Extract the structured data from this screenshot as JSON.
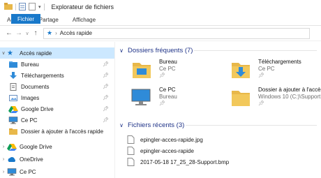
{
  "window": {
    "title": "Explorateur de fichiers"
  },
  "ribbon": {
    "tabs": [
      "Fichier",
      "Accueil",
      "Partage",
      "Affichage"
    ]
  },
  "address": {
    "path": "Accès rapide"
  },
  "sidebar": {
    "quick_access": "Accès rapide",
    "items": [
      {
        "label": "Bureau",
        "icon": "desktop-folder-icon"
      },
      {
        "label": "Téléchargements",
        "icon": "download-icon"
      },
      {
        "label": "Documents",
        "icon": "documents-icon"
      },
      {
        "label": "Images",
        "icon": "pictures-icon"
      },
      {
        "label": "Google Drive",
        "icon": "google-drive-icon"
      },
      {
        "label": "Ce PC",
        "icon": "computer-icon"
      },
      {
        "label": "Dossier à ajouter à l'accès rapide",
        "icon": "folder-icon"
      }
    ],
    "roots": [
      {
        "label": "Google Drive",
        "icon": "google-drive-icon"
      },
      {
        "label": "OneDrive",
        "icon": "onedrive-icon"
      },
      {
        "label": "Ce PC",
        "icon": "computer-icon"
      }
    ]
  },
  "frequent": {
    "header": "Dossiers fréquents (7)",
    "tiles": [
      {
        "name": "Bureau",
        "sub": "Ce PC"
      },
      {
        "name": "Téléchargements",
        "sub": "Ce PC"
      },
      {
        "name": "Ce PC",
        "sub": "Bureau"
      },
      {
        "name": "Dossier à ajouter à l'accès...",
        "sub": "Windows 10 (C:)\\Support"
      }
    ]
  },
  "recent": {
    "header": "Fichiers récents (3)",
    "files": [
      "epingler-acces-rapide.jpg",
      "epingler-acces-rapide",
      "2017-05-18 17_25_28-Support.bmp"
    ]
  },
  "colors": {
    "accent": "#1979ca",
    "selection": "#cce8ff",
    "folder": "#e8b84a",
    "group_header": "#1e3287"
  }
}
